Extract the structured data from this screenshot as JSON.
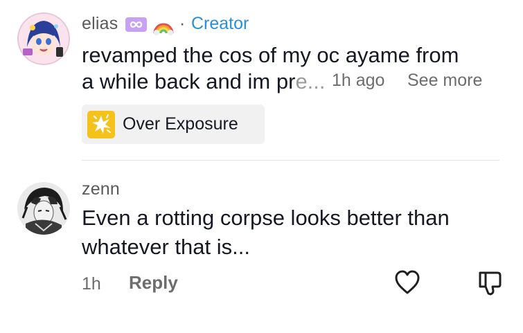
{
  "comment1": {
    "username": "elias",
    "badge_separator": "·",
    "creator_label": "Creator",
    "text_line1": "revamped the cos of my oc ayame from",
    "text_line2_start": "a while back and im pr",
    "text_line2_fade": "e...",
    "time": "1h ago",
    "see_more": "See more",
    "effect_label": "Over Exposure"
  },
  "comment2": {
    "username": "zenn",
    "text_line1": "Even a rotting corpse looks better than",
    "text_line2": "whatever that is...",
    "time": "1h",
    "reply": "Reply"
  },
  "colors": {
    "creator": "#2b8fd6",
    "effect_icon": "#f4c21a",
    "infinity_badge": "#c7a2f2"
  },
  "icons": {
    "infinity_badge": "infinity-icon",
    "rainbow_badge": "rainbow-icon",
    "effect": "sparkle-burst-icon",
    "like": "heart-icon",
    "dislike": "thumbs-down-icon"
  }
}
